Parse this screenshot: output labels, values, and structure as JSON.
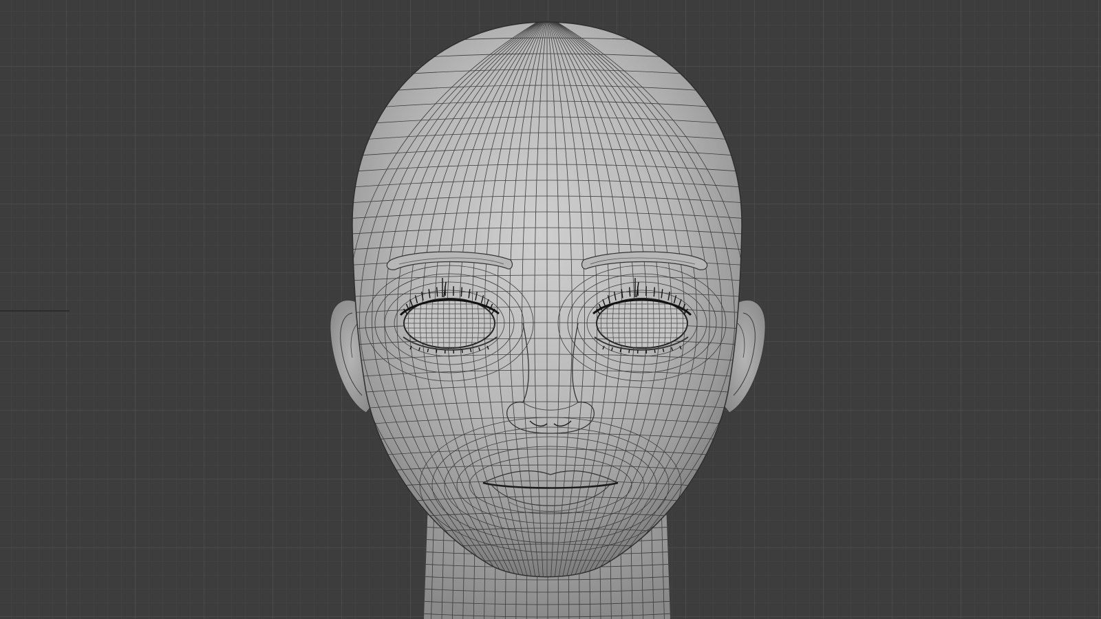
{
  "viewport": {
    "background_color": "#3d3d3d",
    "grid_minor_color": "#474747",
    "grid_major_color": "#505050",
    "model": {
      "subject": "stylized-head-mesh",
      "shading": "solid-grey-with-wireframe",
      "skin_color": "#b9b9b9",
      "wire_color": "#3a3a3a"
    },
    "axis_line_color": "#2a2a2a"
  }
}
